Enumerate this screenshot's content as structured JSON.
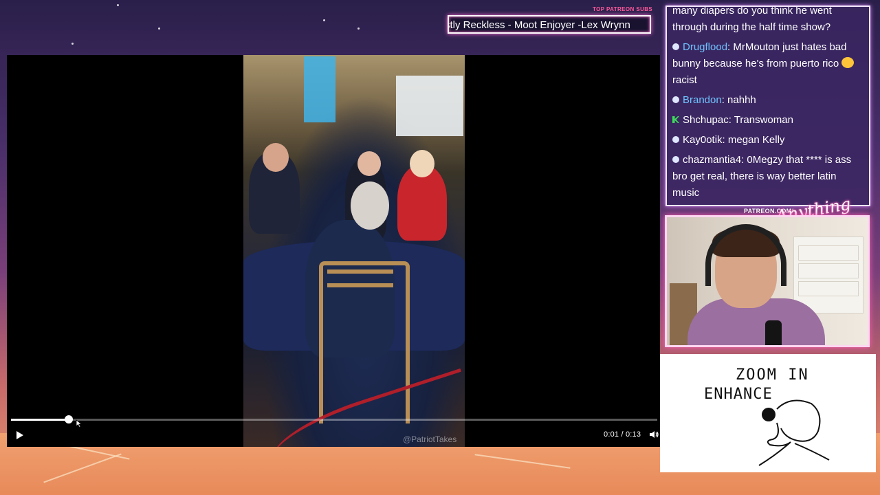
{
  "ticker": {
    "label": "TOP PATREON SUBS",
    "text": "stly Reckless - Moot Enjoyer -Lex Wrynn"
  },
  "chat": {
    "messages": [
      {
        "user": "",
        "text": "many diapers do you think he went through during the half time show?",
        "user_color": "#ffffff",
        "badge": "none"
      },
      {
        "user": "Drugflood",
        "text": ": MrMouton just hates bad bunny because he's from puerto rico",
        "suffix": " racist",
        "user_color": "#6fc3ff",
        "badge": "prime",
        "emoji": "emote"
      },
      {
        "user": "Brandon",
        "text": ": nahhh",
        "user_color": "#6fc3ff",
        "badge": "prime"
      },
      {
        "user": "Shchupac",
        "text": ": Transwoman",
        "user_color": "#ffffff",
        "badge": "kick"
      },
      {
        "user": "Kay0otik",
        "text": ": megan Kelly",
        "user_color": "#ffffff",
        "badge": "prime"
      },
      {
        "user": "chazmantia4",
        "text": ": 0Megzy that **** is ass bro get real, there is way better latin music",
        "user_color": "#ffffff",
        "badge": "prime"
      }
    ]
  },
  "webcam": {
    "patreon_url": "PATREON.COM/",
    "brand_logo": "Anything Else?"
  },
  "video": {
    "watermark": "@PatriotTakes",
    "current_time": "0:01",
    "duration": "0:13",
    "time_text": "0:01 / 0:13",
    "progress_fraction": 0.0895
  },
  "drawing": {
    "line1": "ZOOM IN",
    "line2": "ENHANCE"
  },
  "colors": {
    "accent_pink": "#ff5fb5",
    "chat_user_blue": "#6fc3ff"
  },
  "icons": {
    "play": "play-icon",
    "volume": "volume-icon",
    "cursor": "cursor-icon"
  }
}
